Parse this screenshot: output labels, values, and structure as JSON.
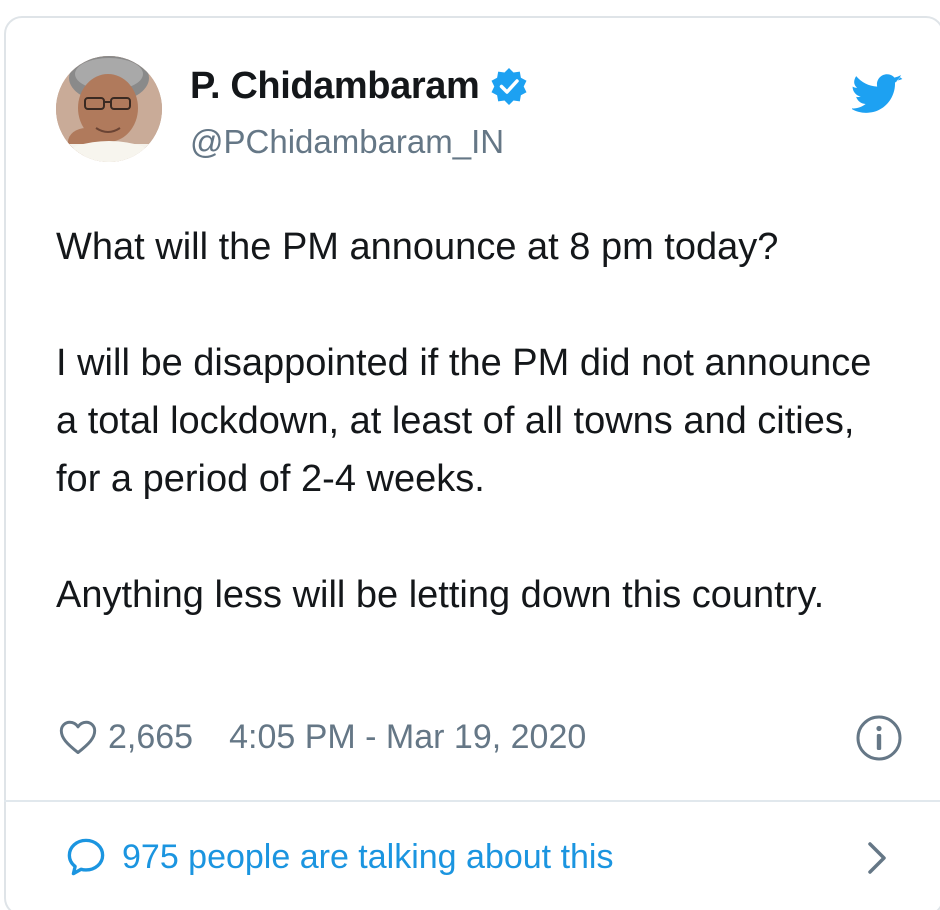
{
  "author": {
    "display_name": "P. Chidambaram",
    "handle": "@PChidambaram_IN",
    "verified": true,
    "avatar_icon": "profile-photo"
  },
  "tweet": {
    "paragraphs": [
      "What will the PM announce at 8 pm today?",
      "I will be disappointed if the PM did not announce a total lockdown, at least of all towns and cities, for a period of 2-4 weeks.",
      "Anything less will be letting down this country."
    ]
  },
  "meta": {
    "like_count": "2,665",
    "timestamp": "4:05 PM - Mar 19, 2020"
  },
  "footer": {
    "talking_text": "975 people are talking about this"
  },
  "icons": {
    "platform": "twitter-bird-icon",
    "like": "heart-icon",
    "info": "info-icon",
    "reply": "speech-bubble-icon",
    "chevron": "chevron-right-icon"
  },
  "colors": {
    "brand_blue": "#1da1f2",
    "link_blue": "#1b95e0",
    "text": "#14171a",
    "secondary_text": "#657786",
    "border": "#dfe4e8"
  }
}
